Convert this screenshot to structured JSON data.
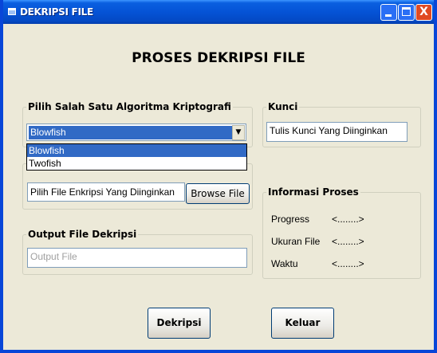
{
  "window": {
    "title": "DEKRIPSI FILE",
    "controls": {
      "minimize": "minimize",
      "maximize": "maximize",
      "close": "X"
    }
  },
  "heading": "PROSES DEKRIPSI FILE",
  "algorithm": {
    "legend": "Pilih Salah Satu Algoritma Kriptografi",
    "selected": "Blowfish",
    "options": [
      "Blowfish",
      "Twofish"
    ]
  },
  "key": {
    "legend": "Kunci",
    "value": "Tulis Kunci Yang Diinginkan"
  },
  "input_file": {
    "value": "Pilih File Enkripsi Yang Diinginkan",
    "browse_label": "Browse File"
  },
  "output_file": {
    "legend": "Output File Dekripsi",
    "placeholder": "Output File"
  },
  "info": {
    "legend": "Informasi Proses",
    "rows": [
      {
        "label": "Progress",
        "value": "<........>"
      },
      {
        "label": "Ukuran File",
        "value": "<........>"
      },
      {
        "label": "Waktu",
        "value": "<........>"
      }
    ]
  },
  "buttons": {
    "decrypt": "Dekripsi",
    "exit": "Keluar"
  }
}
